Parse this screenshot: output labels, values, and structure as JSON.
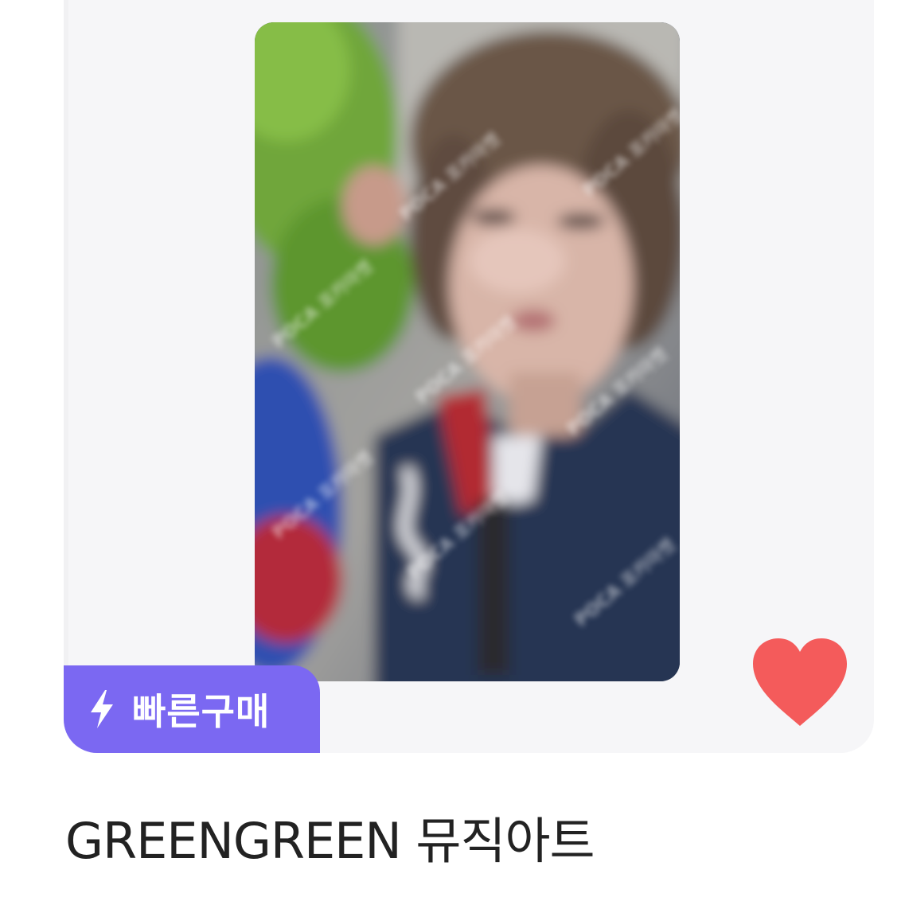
{
  "product": {
    "image_icon": "photocard-image",
    "badge": {
      "icon": "lightning-bolt-icon",
      "label": "빠른구매",
      "color": "#7b68f2"
    },
    "favorite": {
      "icon": "heart-icon",
      "color": "#f45b5b",
      "active": true
    },
    "title": "GREENGREEN 뮤직아트",
    "watermark": "POCA 포카마켓"
  }
}
